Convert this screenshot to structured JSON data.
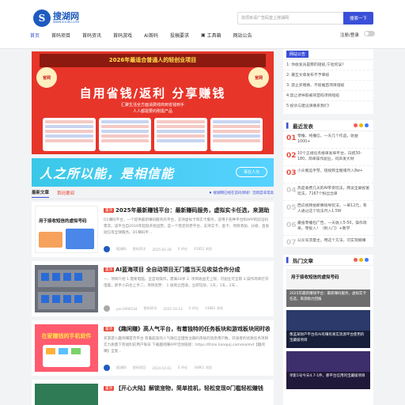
{
  "header": {
    "logo_text": "搜湖网",
    "logo_url": "WWW.SOUHU.COM",
    "logo_letter": "S",
    "search_placeholder": "找项目请广告码登上搜湖网",
    "search_button": "搜索一下",
    "nav": [
      {
        "label": "首页"
      },
      {
        "label": "首码项目"
      },
      {
        "label": "首码资讯"
      },
      {
        "label": "首码游戏"
      },
      {
        "label": "AI首码"
      },
      {
        "label": "投稿要求"
      },
      {
        "label": "工具箱",
        "icon": "toolbox-icon"
      },
      {
        "label": "网站公告"
      }
    ],
    "login": "注册/登录"
  },
  "banner": {
    "top_line": "2026年最适合普通人的轻创业项目",
    "badge_left": "官网",
    "badge_right": "官网",
    "main": "自用省钱/返利  分享赚钱",
    "sub1": "汇聚生活全方面消费线商到省钱到手",
    "sub2": "人人都需要的刚需产品"
  },
  "ad": {
    "slogan": "人之所以能，是相信能",
    "chip": "事在人为"
  },
  "tabs": {
    "items": [
      "最新文章",
      "首码要闻"
    ],
    "right_text": "♦ 搜湖网已经在首码领域！活跃度非常高"
  },
  "articles": [
    {
      "tag": "置顶",
      "title": "2025年最新赚钱平台：最新赚码服务，虚拟实卡任选，来测助力回报",
      "desc": "D1赚码平台，一个提供最新赚码服务的平台，支持虚拟卡和实卡服务，适用于各种平台和APP的验证码需求。该平台自2019年起就开始运营，是一个稳定的老平台，支持实卡、虚卡、项目添加、分级、直发短信等全球服务。D1赚码平...",
      "author": "搜湖网",
      "category": "首码资讯",
      "date": "2025-02-28",
      "comments": "0 评论",
      "views": "41852 浏览",
      "img_text": "用于接收短信的虚拟号码"
    },
    {
      "tag": "置顶",
      "title": "AI蓝海项目 全自动项目无门槛当天见收益合作分成",
      "desc": "一、项目介绍 1.需要电脑，全自动操作，需满18岁 2. 项目收益无上限，可副业可全职 3.操作简单打开电脑，新手小白也上手二、项目优势： 1.投资立回收，立即见效，1天，1天，2天...",
      "author": "pen1990234",
      "category": "首码资讯",
      "date": "2025-10-13",
      "comments": "0 评论",
      "views": "14881 浏览",
      "img_text": ""
    },
    {
      "tag": "置顶",
      "title": "《趣闲赚》高人气平台，有着独特的任务板块和游戏板块同时收益多多",
      "desc": "买游游入趣闲赚首页平台 有着超高的人气微信全国性注册码审核的消息用户数，开发者的优质任务项目实力质量下有福利前用户每日 下载趣闲赚APP活动链接：https://thzie.lianquij.com/eialmd【趣闲赚】全套...",
      "author": "搜湖网",
      "category": "首码项目",
      "date": "2024-10-01",
      "comments": "0 评论",
      "views": "34861 浏览",
      "img_text": "在家赚钱的手机软件"
    },
    {
      "tag": "置顶",
      "title": "【开心大陆】解锁宠物，简单挂机，轻松变现0门槛轻松赚钱",
      "desc": "",
      "author": "",
      "category": "",
      "date": "",
      "comments": "",
      "views": "",
      "img_text": ""
    }
  ],
  "notice": {
    "label": "网站公告",
    "items": [
      "1: 你收发员是那的短缆,宁验何误？",
      "2: 著互文章发布不予审核",
      "3: 禁止买赠换、不揽推首项目短缆",
      "4:禁止诱导取被同首码项目短缆",
      "5:投诉与建议请联系我们！"
    ]
  },
  "recent": {
    "title": "最近发表",
    "items": [
      {
        "num": "01",
        "text": "零撸，纯撸信，一天几个作品，收益1000+"
      },
      {
        "num": "02",
        "text": "10个正规任务接单发单平台，日结30-180，简单操作副业，闷声发大财"
      },
      {
        "num": "03",
        "text": "小众搬运手赞，短视频全搬储月入8w+"
      },
      {
        "num": "04",
        "text": "热度收费几天的AI带货玩法，两谈全屏投富玩法，7167个粉丝出单"
      },
      {
        "num": "05",
        "text": "西瓜视频拍新赛指导玩法，一单12元，有人通过这个玩法月入1.5W"
      },
      {
        "num": "06",
        "text": "最强零撸包广告，一天收入5-50，操作简单，零投入！（附入门）+教学"
      },
      {
        "num": "07",
        "text": "公众号流量主，用这个方法，可实现躺赚"
      }
    ]
  },
  "hot": {
    "title": "热门文章",
    "items": [
      {
        "text": "用于接收短信的虚拟号码",
        "caption": "2025年最新赚钱平台：最新赚码服务，虚拟实卡任选，来测助力回报"
      },
      {
        "text": "",
        "caption": "像蓝某财产平台有AI有赚有真实资源平台使用的宝藏级项目"
      },
      {
        "text": "",
        "caption": "单影1号今天4.7-1件，那平台信用的宝藏级项目"
      }
    ]
  },
  "colors": {
    "accent": "#3a4fd8",
    "brand": "#1e5bbf",
    "tag_red": "#e74c3c",
    "dot_red": "#f25a5a",
    "dot_yellow": "#f5b400",
    "dot_blue": "#3a7df5"
  }
}
